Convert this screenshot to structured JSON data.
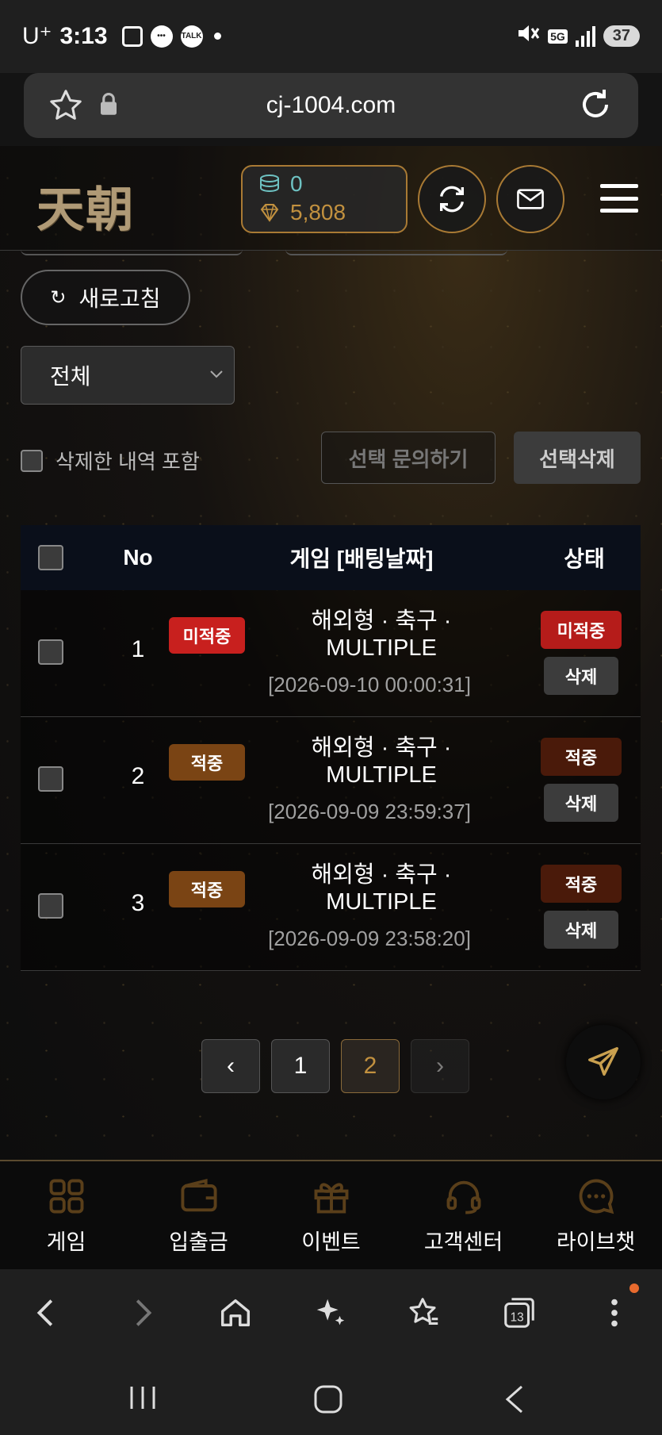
{
  "status_bar": {
    "carrier": "U⁺",
    "time": "3:13",
    "talk_label": "TALK",
    "network": "5G",
    "battery": "37"
  },
  "browser": {
    "url": "cj-1004.com"
  },
  "header": {
    "logo": "天朝",
    "wallet": {
      "coins": "0",
      "points": "5,808"
    }
  },
  "filters": {
    "refresh_label": "새로고침",
    "select_value": "전체",
    "include_deleted_label": "삭제한 내역 포함",
    "inquiry_button": "선택 문의하기",
    "delete_selected_button": "선택삭제"
  },
  "table": {
    "headers": {
      "no": "No",
      "game": "게임 [배팅날짜]",
      "status": "상태"
    },
    "rows": [
      {
        "no": "1",
        "badge": "미적중",
        "title_line1": "해외형 · 축구 ·",
        "title_line2": "MULTIPLE",
        "date": "[2026-09-10 00:00:31]",
        "status": "미적중",
        "delete": "삭제"
      },
      {
        "no": "2",
        "badge": "적중",
        "title_line1": "해외형 · 축구 ·",
        "title_line2": "MULTIPLE",
        "date": "[2026-09-09 23:59:37]",
        "status": "적중",
        "delete": "삭제"
      },
      {
        "no": "3",
        "badge": "적중",
        "title_line1": "해외형 · 축구 ·",
        "title_line2": "MULTIPLE",
        "date": "[2026-09-09 23:58:20]",
        "status": "적중",
        "delete": "삭제"
      }
    ]
  },
  "pagination": {
    "pages": [
      "1",
      "2"
    ],
    "current": "2",
    "prev": "‹",
    "next": "›"
  },
  "bottom_nav": [
    {
      "label": "게임",
      "icon": "grid-icon"
    },
    {
      "label": "입출금",
      "icon": "wallet-icon"
    },
    {
      "label": "이벤트",
      "icon": "gift-icon"
    },
    {
      "label": "고객센터",
      "icon": "headset-icon"
    },
    {
      "label": "라이브챗",
      "icon": "chat-icon"
    }
  ],
  "browser_toolbar": {
    "tabs_count": "13"
  },
  "colors": {
    "accent_gold": "#c2913f",
    "miss_red": "#c8201e",
    "hit_brown": "#7a4414",
    "coin_teal": "#6ec2c2"
  }
}
